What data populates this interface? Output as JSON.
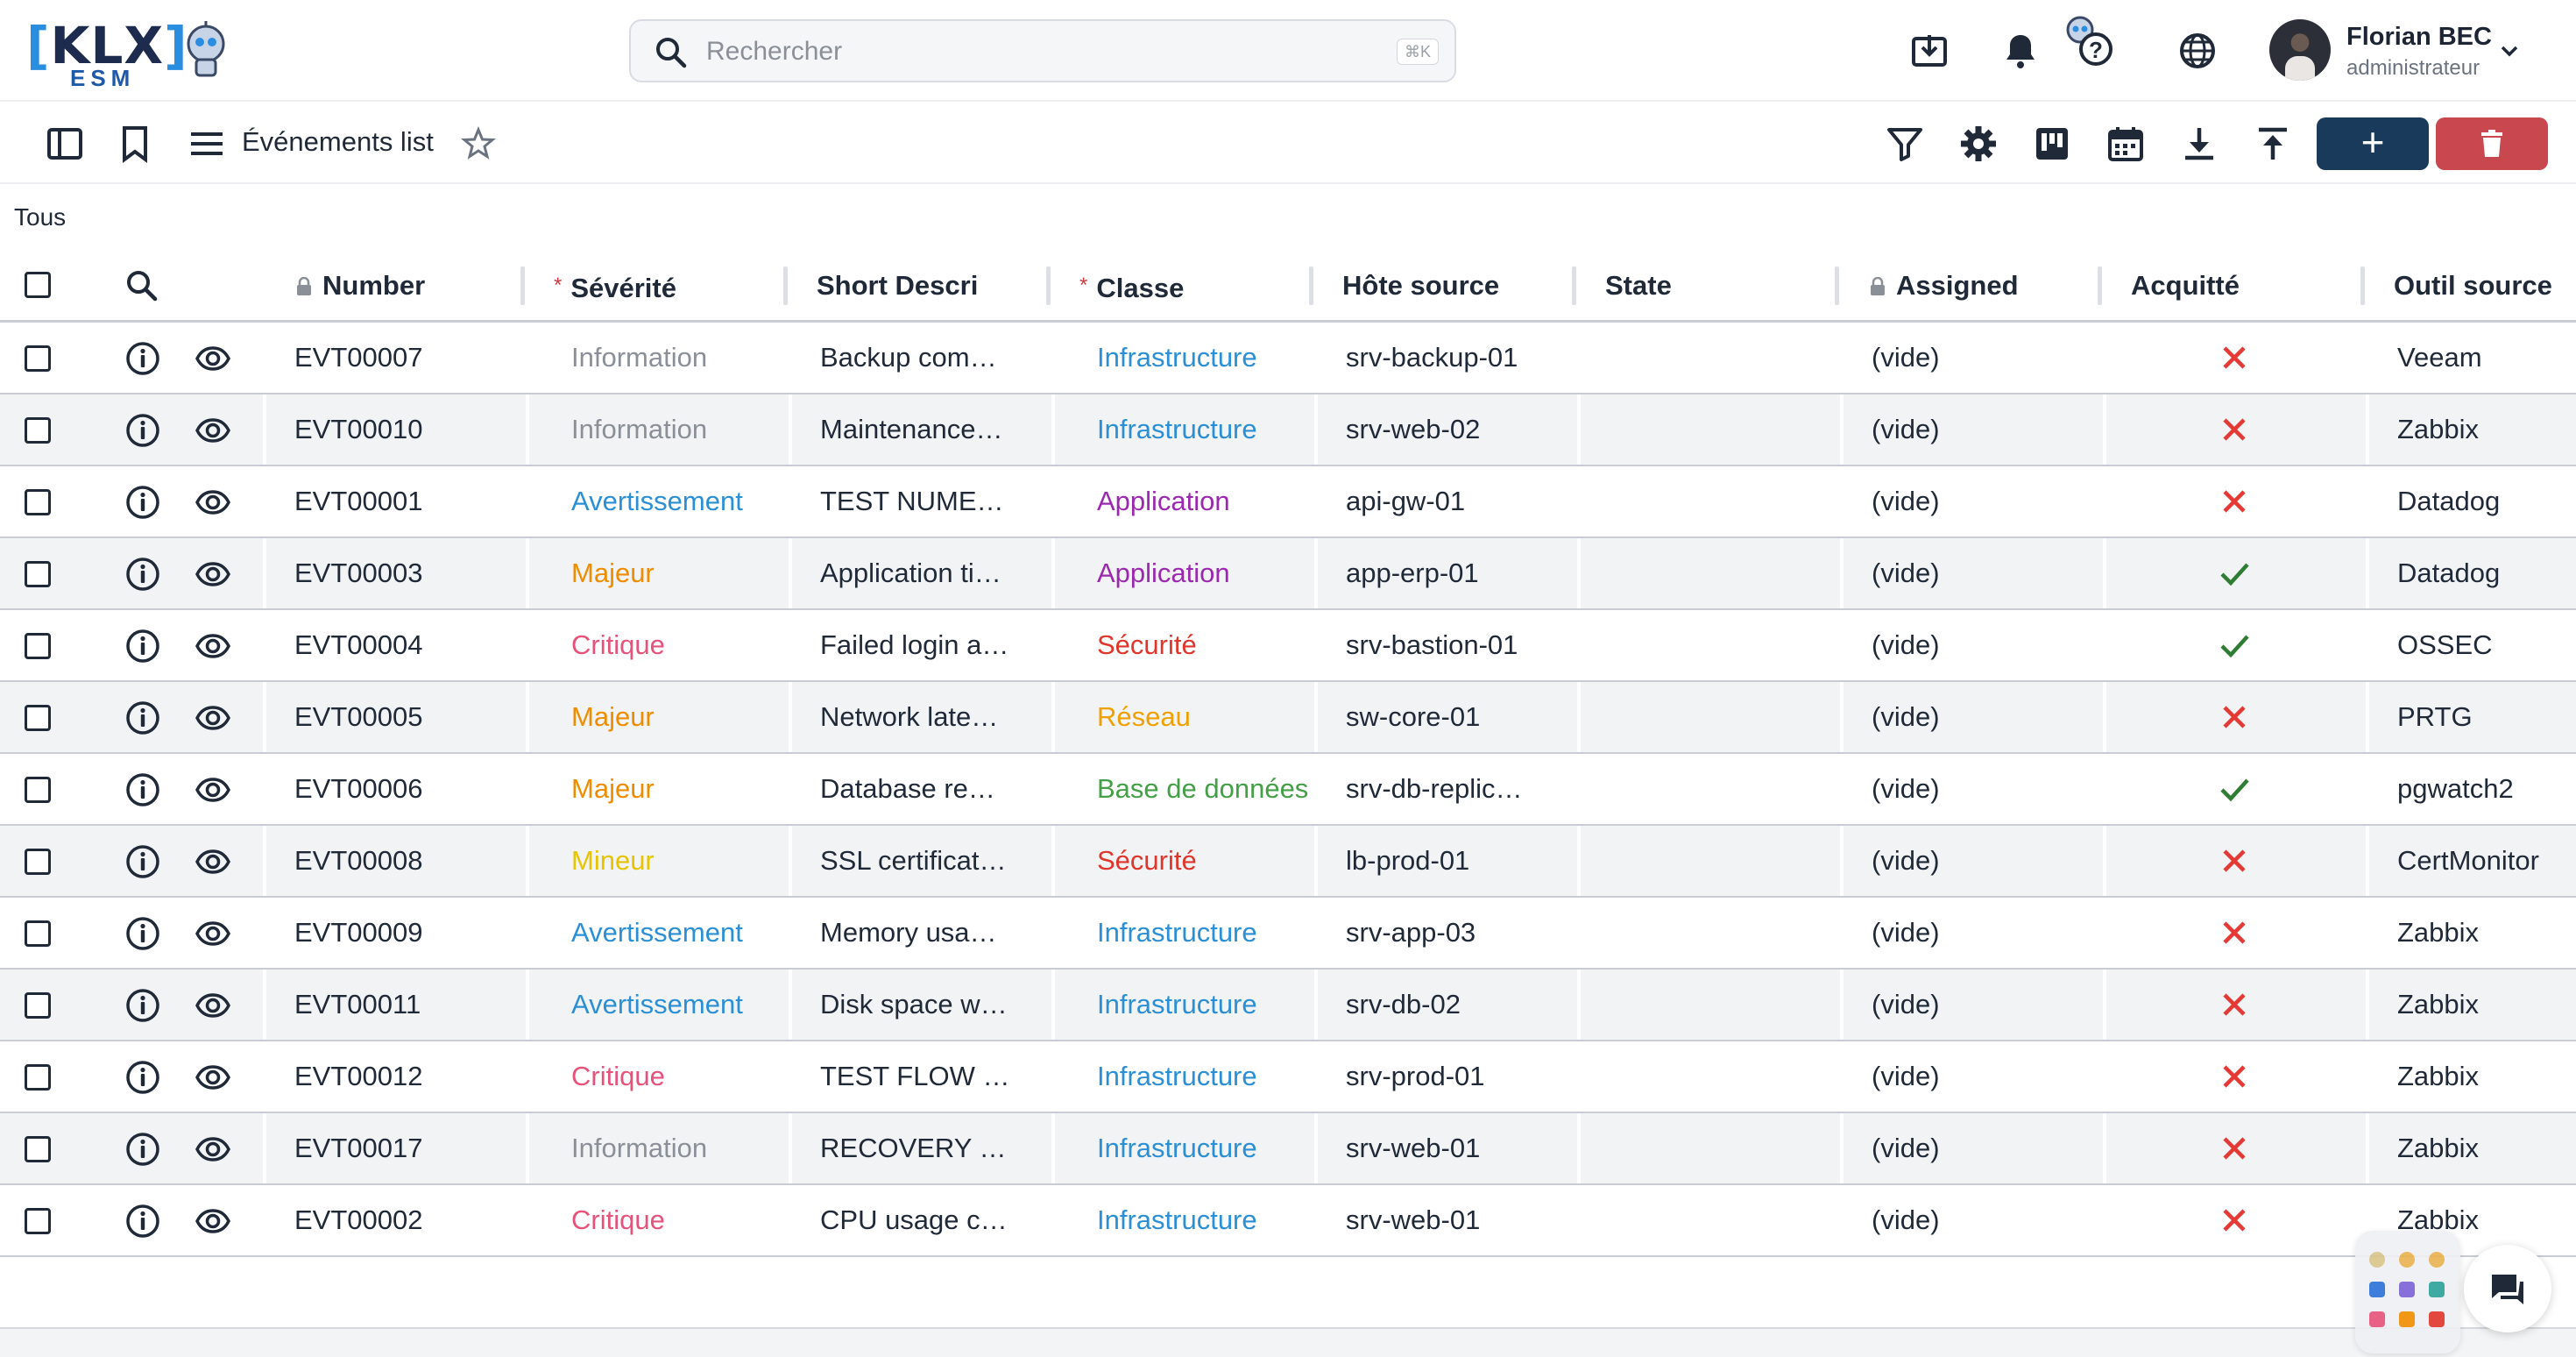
{
  "app": {
    "logo_text": "[KLX]",
    "logo_sub": "ESM"
  },
  "search": {
    "placeholder": "Rechercher",
    "shortcut": "⌘K"
  },
  "user": {
    "name": "Florian BEC",
    "role": "administrateur"
  },
  "toolbar": {
    "title": "Événements list",
    "add_label": "+"
  },
  "filter": {
    "label": "Tous"
  },
  "colors": {
    "Information": "#8a8f98",
    "Avertissement": "#2b8fd6",
    "Majeur": "#f08c00",
    "Critique": "#e6527a",
    "Mineur": "#e8c400",
    "Infrastructure": "#2b8fd6",
    "Application": "#9c27b0",
    "Sécurité": "#e0352b",
    "Réseau": "#f0a000",
    "Base de données": "#43a047",
    "ack_yes": "#2e7d32",
    "ack_no": "#e53935"
  },
  "columns": [
    {
      "key": "number",
      "label": "Number",
      "locked": true,
      "required": false
    },
    {
      "key": "severity",
      "label": "Sévérité",
      "locked": false,
      "required": true
    },
    {
      "key": "short_desc",
      "label": "Short Descri",
      "locked": false,
      "required": false
    },
    {
      "key": "class",
      "label": "Classe",
      "locked": false,
      "required": true
    },
    {
      "key": "host",
      "label": "Hôte source",
      "locked": false,
      "required": false
    },
    {
      "key": "state",
      "label": "State",
      "locked": false,
      "required": false
    },
    {
      "key": "assigned",
      "label": "Assigned",
      "locked": true,
      "required": false
    },
    {
      "key": "ack",
      "label": "Acquitté",
      "locked": false,
      "required": false
    },
    {
      "key": "tool",
      "label": "Outil source",
      "locked": false,
      "required": false
    }
  ],
  "rows": [
    {
      "number": "EVT00007",
      "severity": "Information",
      "short_desc": "Backup com…",
      "class": "Infrastructure",
      "host": "srv-backup-01",
      "state": "",
      "assigned": "(vide)",
      "ack": false,
      "tool": "Veeam"
    },
    {
      "number": "EVT00010",
      "severity": "Information",
      "short_desc": "Maintenance…",
      "class": "Infrastructure",
      "host": "srv-web-02",
      "state": "",
      "assigned": "(vide)",
      "ack": false,
      "tool": "Zabbix"
    },
    {
      "number": "EVT00001",
      "severity": "Avertissement",
      "short_desc": "TEST NUME…",
      "class": "Application",
      "host": "api-gw-01",
      "state": "",
      "assigned": "(vide)",
      "ack": false,
      "tool": "Datadog"
    },
    {
      "number": "EVT00003",
      "severity": "Majeur",
      "short_desc": "Application ti…",
      "class": "Application",
      "host": "app-erp-01",
      "state": "",
      "assigned": "(vide)",
      "ack": true,
      "tool": "Datadog"
    },
    {
      "number": "EVT00004",
      "severity": "Critique",
      "short_desc": "Failed login a…",
      "class": "Sécurité",
      "host": "srv-bastion-01",
      "state": "",
      "assigned": "(vide)",
      "ack": true,
      "tool": "OSSEC"
    },
    {
      "number": "EVT00005",
      "severity": "Majeur",
      "short_desc": "Network late…",
      "class": "Réseau",
      "host": "sw-core-01",
      "state": "",
      "assigned": "(vide)",
      "ack": false,
      "tool": "PRTG"
    },
    {
      "number": "EVT00006",
      "severity": "Majeur",
      "short_desc": "Database re…",
      "class": "Base de données",
      "host": "srv-db-replic…",
      "state": "",
      "assigned": "(vide)",
      "ack": true,
      "tool": "pgwatch2"
    },
    {
      "number": "EVT00008",
      "severity": "Mineur",
      "short_desc": "SSL certificat…",
      "class": "Sécurité",
      "host": "lb-prod-01",
      "state": "",
      "assigned": "(vide)",
      "ack": false,
      "tool": "CertMonitor"
    },
    {
      "number": "EVT00009",
      "severity": "Avertissement",
      "short_desc": "Memory usa…",
      "class": "Infrastructure",
      "host": "srv-app-03",
      "state": "",
      "assigned": "(vide)",
      "ack": false,
      "tool": "Zabbix"
    },
    {
      "number": "EVT00011",
      "severity": "Avertissement",
      "short_desc": "Disk space w…",
      "class": "Infrastructure",
      "host": "srv-db-02",
      "state": "",
      "assigned": "(vide)",
      "ack": false,
      "tool": "Zabbix"
    },
    {
      "number": "EVT00012",
      "severity": "Critique",
      "short_desc": "TEST FLOW …",
      "class": "Infrastructure",
      "host": "srv-prod-01",
      "state": "",
      "assigned": "(vide)",
      "ack": false,
      "tool": "Zabbix"
    },
    {
      "number": "EVT00017",
      "severity": "Information",
      "short_desc": "RECOVERY …",
      "class": "Infrastructure",
      "host": "srv-web-01",
      "state": "",
      "assigned": "(vide)",
      "ack": false,
      "tool": "Zabbix"
    },
    {
      "number": "EVT00002",
      "severity": "Critique",
      "short_desc": "CPU usage c…",
      "class": "Infrastructure",
      "host": "srv-web-01",
      "state": "",
      "assigned": "(vide)",
      "ack": false,
      "tool": "Zabbix"
    }
  ]
}
